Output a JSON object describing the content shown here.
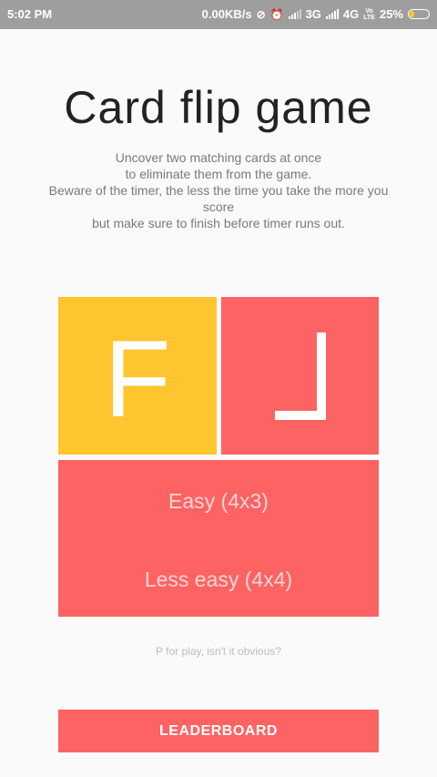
{
  "status_bar": {
    "time": "5:02 PM",
    "network_speed": "0.00KB/s",
    "network_type_1": "3G",
    "network_type_2": "4G",
    "volte_top": "Vo",
    "volte_bottom": "LTE",
    "battery_percent": "25%",
    "battery_level": 0.25,
    "icons": [
      "mute-icon",
      "alarm-icon",
      "signal-icon",
      "signal-icon",
      "battery-icon"
    ]
  },
  "app": {
    "title": "Card flip game",
    "description_lines": [
      "Uncover two matching cards at once",
      "to eliminate them from the game.",
      "Beware of the timer, the less the time you take the more you",
      "score",
      "but make sure to finish before timer runs out."
    ],
    "tiles": {
      "left_letter": "F",
      "right_glyph": "corner-glyph"
    },
    "difficulty": {
      "easy": "Easy (4x3)",
      "less_easy": "Less easy (4x4)"
    },
    "hint": "P for play, isn't it obvious?",
    "leaderboard_label": "LEADERBOARD"
  },
  "colors": {
    "yellow": "#fec52e",
    "red": "#fd6363",
    "status_bar": "#9e9e9e",
    "background": "#fafafa"
  }
}
